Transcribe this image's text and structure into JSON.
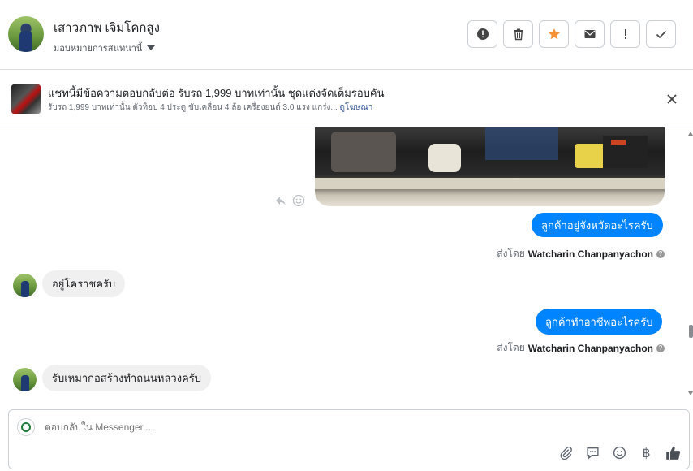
{
  "header": {
    "name": "เสาวภาพ เจิมโคกสูง",
    "assign_label": "มอบหมายการสนทนานี้",
    "actions": [
      "important",
      "delete",
      "star",
      "email",
      "spam",
      "done"
    ]
  },
  "ad": {
    "title": "แชทนี้มีข้อความตอบกลับต่อ รับรถ 1,999 บาทเท่านั้น ชุดแต่งจัดเต็มรอบคัน",
    "subtitle": "รับรถ 1,999 บาทเท่านั้น ตัวท็อป 4 ประตู ขับเคลื่อน 4 ล้อ เครื่องยนต์ 3.0 แรง แกร่ง...",
    "link": "ดูโฆษณา"
  },
  "messages": [
    {
      "side": "out",
      "text": "ลูกค้าอยู่จังหวัดอะไรครับ"
    },
    {
      "side": "in",
      "text": "อยู่โคราชครับ"
    },
    {
      "side": "out",
      "text": "ลูกค้าทำอาชีพอะไรครับ"
    },
    {
      "side": "in",
      "text": "รับเหมาก่อสร้างทำถนนหลวงครับ"
    }
  ],
  "sender_prefix": "ส่งโดย",
  "sender_name": "Watcharin Chanpanyachon",
  "composer": {
    "placeholder": "ตอบกลับใน Messenger..."
  },
  "colors": {
    "outgoing": "#0084ff",
    "incoming": "#f1f0f0",
    "star": "#f7923b",
    "like": "#4b4f56"
  }
}
